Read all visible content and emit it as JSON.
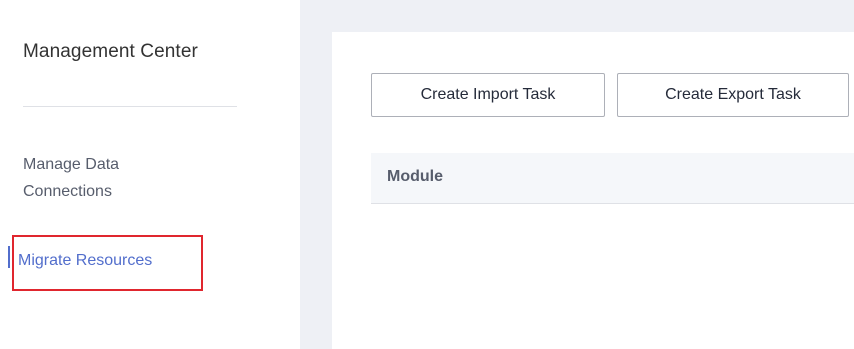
{
  "sidebar": {
    "title": "Management Center",
    "items": [
      {
        "label": "Manage Data\nConnections",
        "line1": "Manage Data",
        "line2": "Connections"
      },
      {
        "label": "Migrate Resources"
      }
    ]
  },
  "toolbar": {
    "import_label": "Create Import Task",
    "export_label": "Create Export Task"
  },
  "table": {
    "columns": [
      "Module"
    ]
  },
  "colors": {
    "accent": "#526ecc",
    "highlight": "#e0262e",
    "main_bg": "#eef0f5"
  }
}
